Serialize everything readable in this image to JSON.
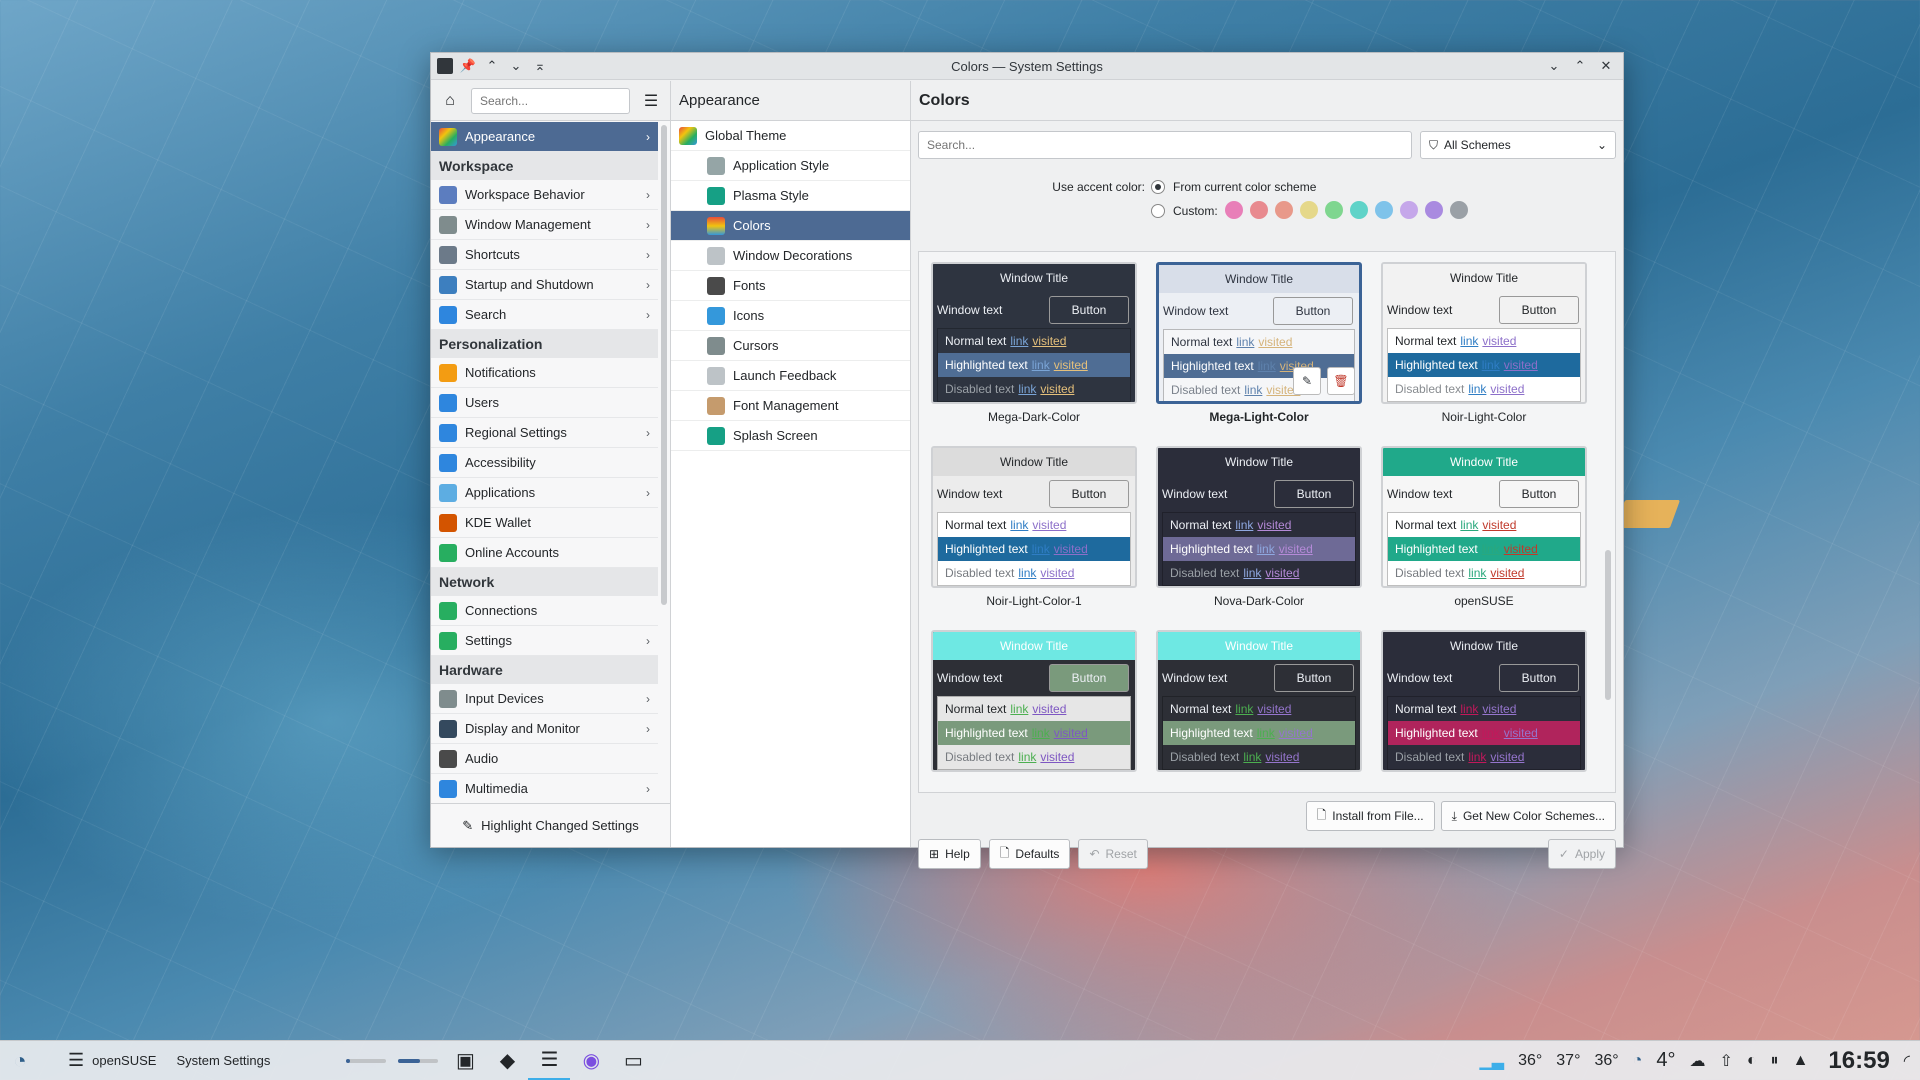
{
  "window": {
    "title": "Colors — System Settings"
  },
  "sidebar": {
    "search_placeholder": "Search...",
    "selected": "Appearance",
    "groups": [
      {
        "header": "",
        "items": [
          {
            "label": "Appearance",
            "icon": "appearance-icon",
            "chevron": true
          }
        ]
      },
      {
        "header": "Workspace",
        "items": [
          {
            "label": "Workspace Behavior",
            "icon": "workspace-behavior-icon",
            "chevron": true
          },
          {
            "label": "Window Management",
            "icon": "window-management-icon",
            "chevron": true
          },
          {
            "label": "Shortcuts",
            "icon": "keyboard-icon",
            "chevron": true
          },
          {
            "label": "Startup and Shutdown",
            "icon": "startup-icon",
            "chevron": true
          },
          {
            "label": "Search",
            "icon": "search-icon",
            "chevron": true
          }
        ]
      },
      {
        "header": "Personalization",
        "items": [
          {
            "label": "Notifications",
            "icon": "bell-icon",
            "chevron": false
          },
          {
            "label": "Users",
            "icon": "user-icon",
            "chevron": false
          },
          {
            "label": "Regional Settings",
            "icon": "regional-icon",
            "chevron": true
          },
          {
            "label": "Accessibility",
            "icon": "accessibility-icon",
            "chevron": false
          },
          {
            "label": "Applications",
            "icon": "applications-icon",
            "chevron": true
          },
          {
            "label": "KDE Wallet",
            "icon": "wallet-icon",
            "chevron": false
          },
          {
            "label": "Online Accounts",
            "icon": "globe-icon",
            "chevron": false
          }
        ]
      },
      {
        "header": "Network",
        "items": [
          {
            "label": "Connections",
            "icon": "globe-icon",
            "chevron": false
          },
          {
            "label": "Settings",
            "icon": "globe-icon",
            "chevron": true
          }
        ]
      },
      {
        "header": "Hardware",
        "items": [
          {
            "label": "Input Devices",
            "icon": "input-devices-icon",
            "chevron": true
          },
          {
            "label": "Display and Monitor",
            "icon": "monitor-icon",
            "chevron": true
          },
          {
            "label": "Audio",
            "icon": "audio-icon",
            "chevron": false
          },
          {
            "label": "Multimedia",
            "icon": "multimedia-icon",
            "chevron": true
          }
        ]
      }
    ],
    "footer_label": "Highlight Changed Settings"
  },
  "middle": {
    "header": "Appearance",
    "items": [
      {
        "label": "Global Theme",
        "icon": "global-theme-icon",
        "top": true
      },
      {
        "label": "Application Style",
        "icon": "app-style-icon"
      },
      {
        "label": "Plasma Style",
        "icon": "plasma-style-icon"
      },
      {
        "label": "Colors",
        "icon": "colors-icon",
        "selected": true
      },
      {
        "label": "Window Decorations",
        "icon": "window-decorations-icon"
      },
      {
        "label": "Fonts",
        "icon": "fonts-icon"
      },
      {
        "label": "Icons",
        "icon": "icons-icon"
      },
      {
        "label": "Cursors",
        "icon": "cursor-icon"
      },
      {
        "label": "Launch Feedback",
        "icon": "launch-feedback-icon"
      },
      {
        "label": "Font Management",
        "icon": "font-management-icon"
      },
      {
        "label": "Splash Screen",
        "icon": "splash-screen-icon"
      }
    ]
  },
  "content": {
    "header": "Colors",
    "search_placeholder": "Search...",
    "filter_value": "All Schemes",
    "accent_label": "Use accent color:",
    "accent_option_current": "From current color scheme",
    "accent_option_custom": "Custom:",
    "accent_swatches": [
      "#e87fb8",
      "#e88a8f",
      "#e8998a",
      "#e5d88a",
      "#7fd68f",
      "#5fd3c8",
      "#7fc3ea",
      "#c5a7ea",
      "#a98ae0",
      "#9aa0a6"
    ],
    "schemes": [
      {
        "name": "Mega-Dark-Color",
        "selected": false,
        "colors": {
          "title_bg": "#2e3440",
          "title_fg": "#eceff4",
          "win_bg": "#2e3440",
          "win_fg": "#eceff4",
          "btn_bg": "#2e3440",
          "btn_fg": "#eceff4",
          "view_bg": "#2e3440",
          "view_fg": "#eceff4",
          "hl_bg": "#4f6d94",
          "hl_fg": "#ffffff",
          "link": "#7aa4d6",
          "visited": "#e5c07b",
          "disabled": "#9aa0a6"
        }
      },
      {
        "name": "Mega-Light-Color",
        "selected": true,
        "colors": {
          "title_bg": "#d8dee9",
          "title_fg": "#2e3440",
          "win_bg": "#eceff4",
          "win_fg": "#2e3440",
          "btn_bg": "#eceff4",
          "btn_fg": "#2e3440",
          "view_bg": "#f5f6f8",
          "view_fg": "#2e3440",
          "hl_bg": "#4f6d94",
          "hl_fg": "#ffffff",
          "link": "#5e81ac",
          "visited": "#d5b37a",
          "disabled": "#7b828c"
        }
      },
      {
        "name": "Noir-Light-Color",
        "selected": false,
        "colors": {
          "title_bg": "#f2f2f2",
          "title_fg": "#232629",
          "win_bg": "#f2f2f2",
          "win_fg": "#232629",
          "btn_bg": "#f2f2f2",
          "btn_fg": "#232629",
          "view_bg": "#ffffff",
          "view_fg": "#232629",
          "hl_bg": "#1e6a9e",
          "hl_fg": "#ffffff",
          "link": "#2f7dc4",
          "visited": "#8c6fc9",
          "disabled": "#888c90"
        }
      },
      {
        "name": "Noir-Light-Color-1",
        "selected": false,
        "colors": {
          "title_bg": "#dcdcdc",
          "title_fg": "#232629",
          "win_bg": "#ececec",
          "win_fg": "#232629",
          "btn_bg": "#ececec",
          "btn_fg": "#232629",
          "view_bg": "#ffffff",
          "view_fg": "#232629",
          "hl_bg": "#1e6a9e",
          "hl_fg": "#ffffff",
          "link": "#2f7dc4",
          "visited": "#8c6fc9",
          "disabled": "#777b80"
        }
      },
      {
        "name": "Nova-Dark-Color",
        "selected": false,
        "colors": {
          "title_bg": "#2b2d3a",
          "title_fg": "#eceff4",
          "win_bg": "#2b2d3a",
          "win_fg": "#eceff4",
          "btn_bg": "#2b2d3a",
          "btn_fg": "#eceff4",
          "view_bg": "#2b2d3a",
          "view_fg": "#eceff4",
          "hl_bg": "#6e6a96",
          "hl_fg": "#ffffff",
          "link": "#8fa8e0",
          "visited": "#b58ad8",
          "disabled": "#9aa0a6"
        }
      },
      {
        "name": "openSUSE",
        "selected": false,
        "colors": {
          "title_bg": "#20a98a",
          "title_fg": "#ffffff",
          "win_bg": "#f6f6f6",
          "win_fg": "#232629",
          "btn_bg": "#f6f6f6",
          "btn_fg": "#232629",
          "view_bg": "#ffffff",
          "view_fg": "#232629",
          "hl_bg": "#20a98a",
          "hl_fg": "#ffffff",
          "link": "#2aa87d",
          "visited": "#c0392b",
          "disabled": "#777b80"
        }
      },
      {
        "name": "",
        "selected": false,
        "colors": {
          "title_bg": "#6ee8e3",
          "title_fg": "#ffffff",
          "win_bg": "#2d2f36",
          "win_fg": "#eceff4",
          "btn_bg": "#7a9a7c",
          "btn_fg": "#eceff4",
          "view_bg": "#e6e6e6",
          "view_fg": "#232629",
          "hl_bg": "#7a9a7c",
          "hl_fg": "#ffffff",
          "link": "#4caf50",
          "visited": "#7e57c2",
          "disabled": "#777b80"
        }
      },
      {
        "name": "",
        "selected": false,
        "colors": {
          "title_bg": "#6ee8e3",
          "title_fg": "#ffffff",
          "win_bg": "#2d2f36",
          "win_fg": "#eceff4",
          "btn_bg": "#2d2f36",
          "btn_fg": "#eceff4",
          "view_bg": "#2d2f36",
          "view_fg": "#eceff4",
          "hl_bg": "#7a9a7c",
          "hl_fg": "#ffffff",
          "link": "#4caf50",
          "visited": "#9575cd",
          "disabled": "#9aa0a6"
        }
      },
      {
        "name": "",
        "selected": false,
        "colors": {
          "title_bg": "#2b2d3a",
          "title_fg": "#eceff4",
          "win_bg": "#2b2d3a",
          "win_fg": "#eceff4",
          "btn_bg": "#2b2d3a",
          "btn_fg": "#eceff4",
          "view_bg": "#2b2d3a",
          "view_fg": "#eceff4",
          "hl_bg": "#b0245c",
          "hl_fg": "#ffffff",
          "link": "#c2185b",
          "visited": "#9575cd",
          "disabled": "#9aa0a6"
        }
      }
    ],
    "preview_text": {
      "title": "Window Title",
      "window_text": "Window text",
      "button": "Button",
      "normal": "Normal text",
      "highlighted": "Highlighted text",
      "disabled": "Disabled text",
      "link": "link",
      "visited": "visited"
    },
    "buttons": {
      "install": "Install from File...",
      "get_new": "Get New Color Schemes...",
      "help": "Help",
      "defaults": "Defaults",
      "reset": "Reset",
      "apply": "Apply"
    }
  },
  "taskbar": {
    "active_task_group": "openSUSE",
    "active_task": "System Settings",
    "temps": [
      "36°",
      "37°",
      "36°"
    ],
    "weather_temp": "4°",
    "clock": "16:59"
  }
}
